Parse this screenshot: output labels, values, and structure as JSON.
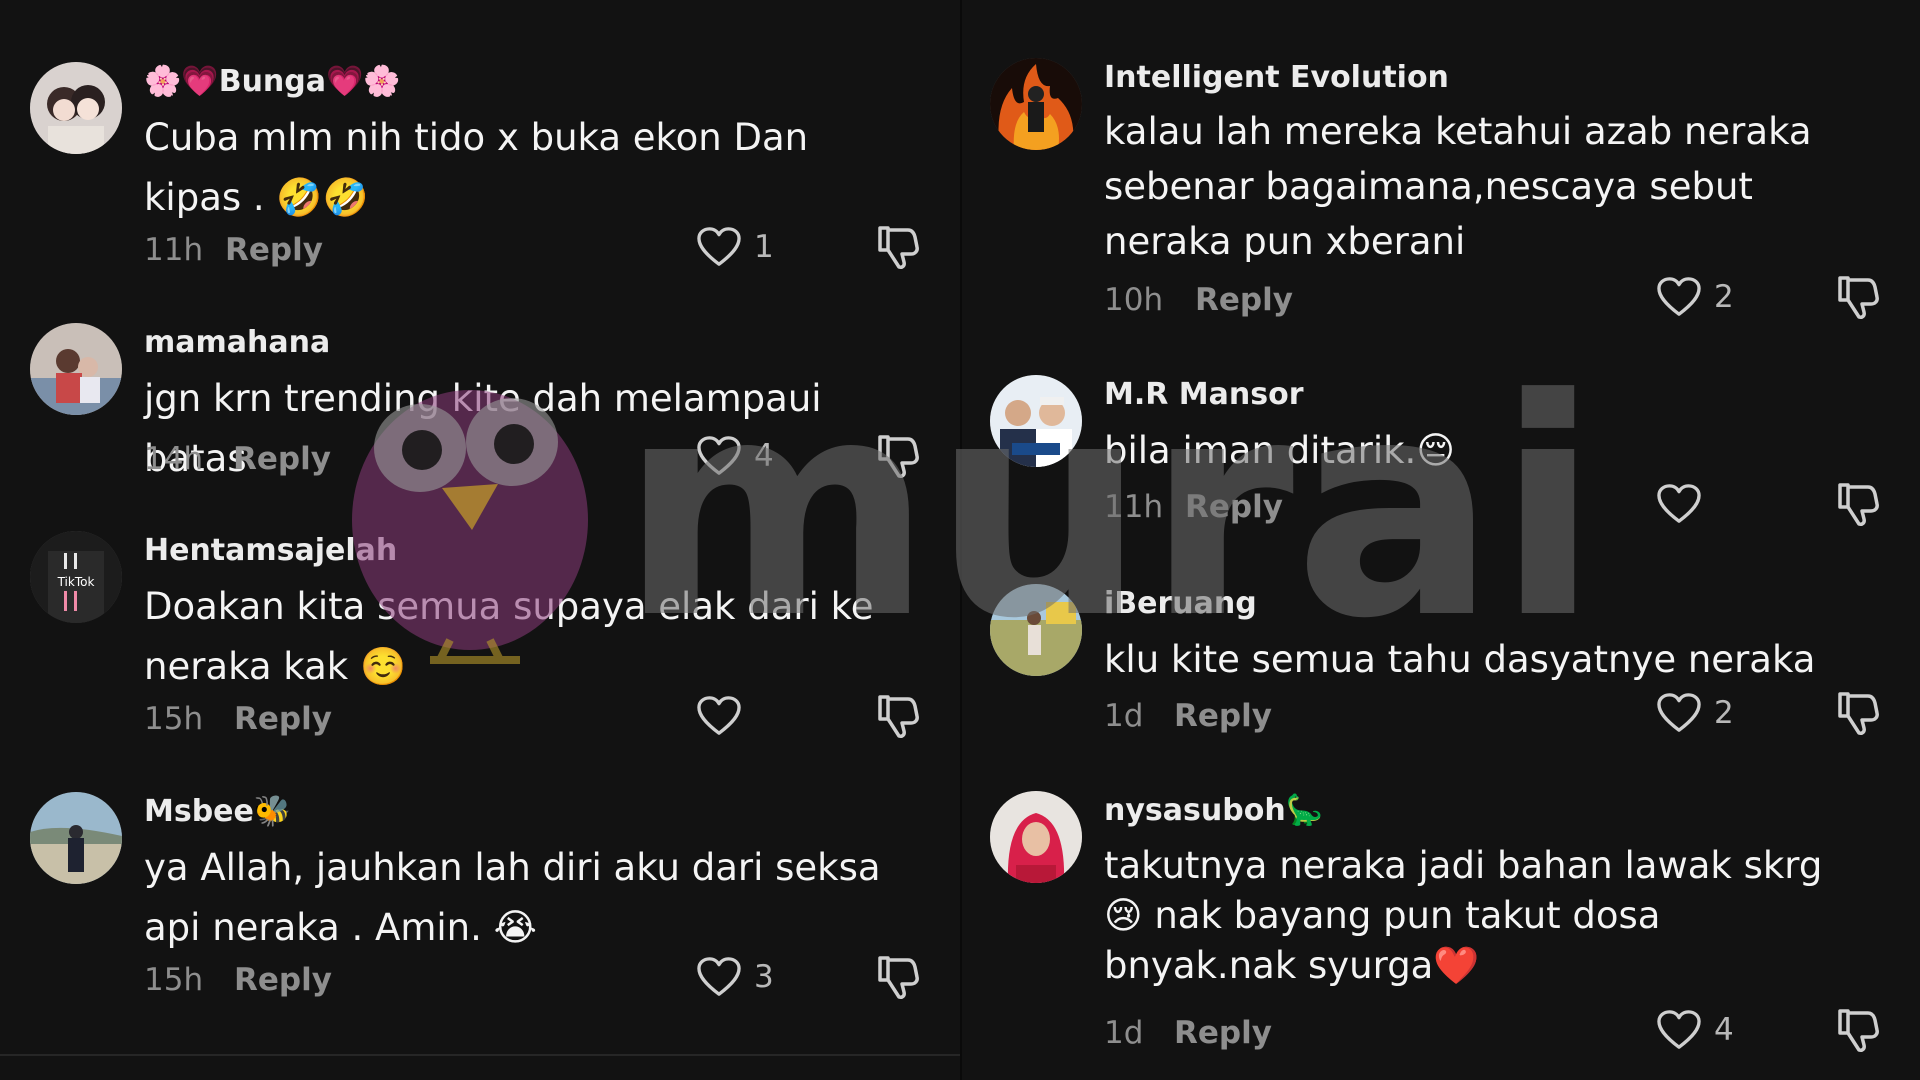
{
  "reply_label": "Reply",
  "left": {
    "comments": [
      {
        "username": "🌸💗Bunga💗🌸",
        "text": "Cuba mlm nih tido x buka ekon Dan kipas . 🤣🤣",
        "time": "11h",
        "likes": "1",
        "avatar_icon": "anime-couple-avatar"
      },
      {
        "username": "mamahana",
        "text": "jgn krn trending kite dah melampaui batas",
        "time": "14h",
        "likes": "4",
        "avatar_icon": "family-photo-avatar"
      },
      {
        "username": "Hentamsajelah",
        "text": "Doakan kita semua supaya elak dari ke neraka kak ☺️",
        "time": "15h",
        "likes": "",
        "avatar_icon": "tiktok-shirt-avatar"
      },
      {
        "username": "Msbee🐝",
        "text": "ya Allah, jauhkan lah diri aku dari seksa api neraka . Amin. 😭",
        "time": "15h",
        "likes": "3",
        "avatar_icon": "beach-person-avatar"
      }
    ]
  },
  "right": {
    "comments": [
      {
        "username": "Intelligent Evolution",
        "text": "kalau lah mereka ketahui azab neraka sebenar bagaimana,nescaya sebut neraka pun xberani",
        "time": "10h",
        "likes": "2",
        "avatar_icon": "flame-figure-avatar"
      },
      {
        "username": "M.R Mansor",
        "text": "bila iman ditarik.😔",
        "time": "11h",
        "likes": "",
        "avatar_icon": "politicians-avatar"
      },
      {
        "username": "iBeruang",
        "text": "klu kite semua tahu dasyatnye neraka",
        "time": "1d",
        "likes": "2",
        "avatar_icon": "outdoor-person-avatar"
      },
      {
        "username": "nysasuboh🦕",
        "text": "takutnya neraka jadi bahan lawak skrg😢 nak bayang pun takut dosa bnyak.nak syurga❤️",
        "time": "1d",
        "likes": "4",
        "avatar_icon": "hijab-woman-avatar"
      }
    ]
  },
  "watermark": {
    "text": "murai",
    "logo_icon": "bird-logo-icon"
  },
  "colors": {
    "background": "#121212",
    "text": "#f4f4f4",
    "muted": "#8e8e8e",
    "watermark": "#6e6e6e",
    "bird": "#8a3a7a"
  }
}
